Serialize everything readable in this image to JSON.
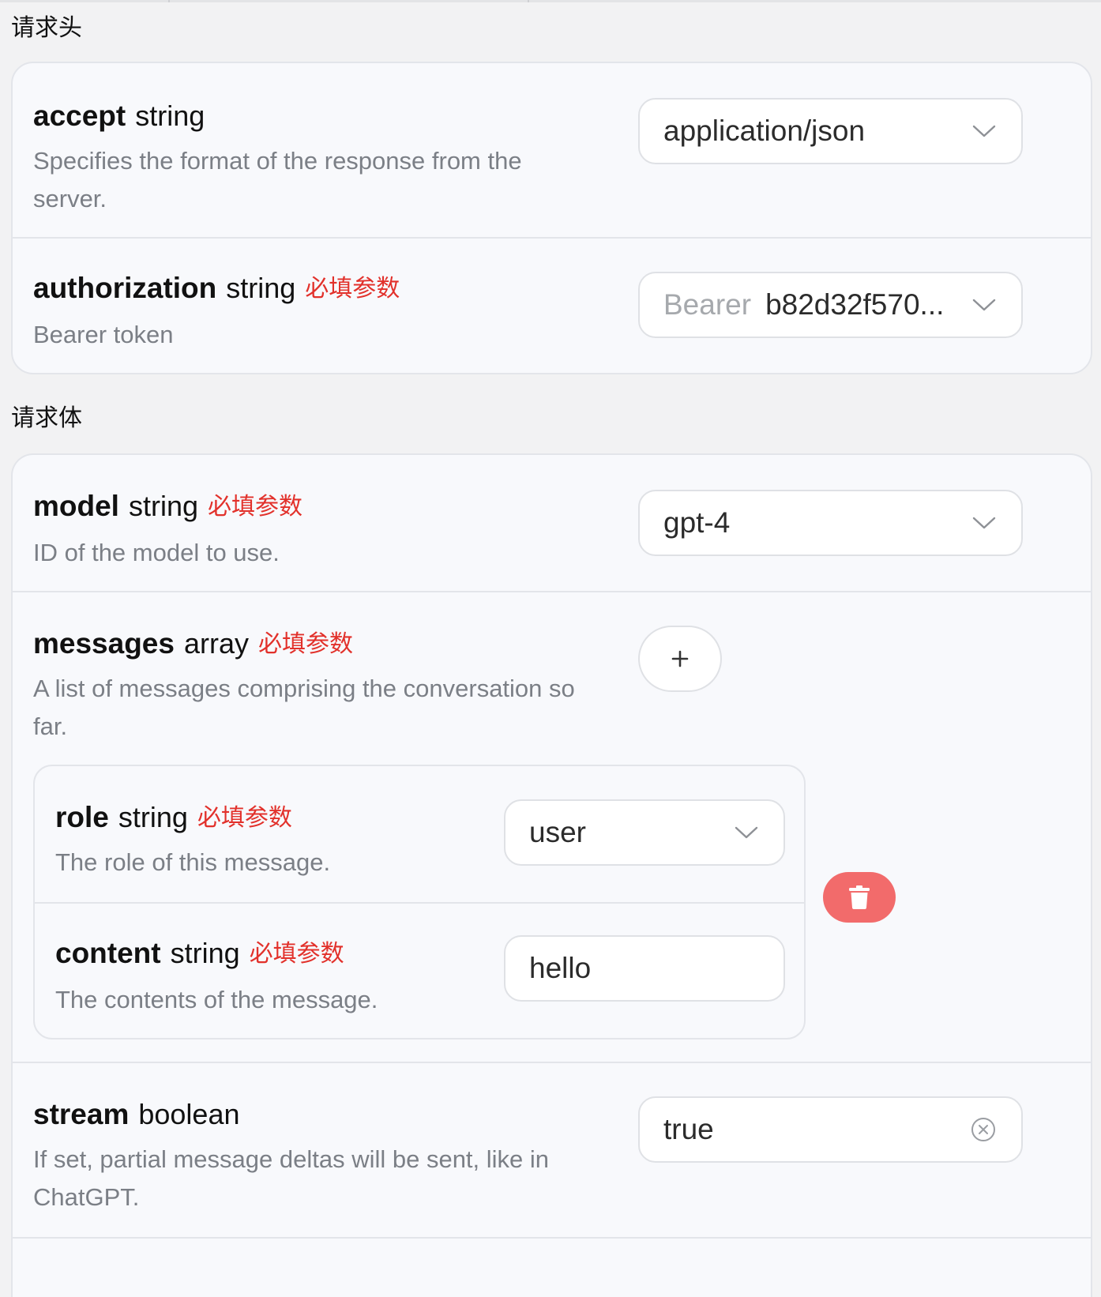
{
  "headers_section": {
    "title": "请求头",
    "params": [
      {
        "name": "accept",
        "type": "string",
        "required": false,
        "description_lines": [
          "Specifies the format of the response from the",
          "server."
        ],
        "value": "application/json",
        "control": "select"
      },
      {
        "name": "authorization",
        "type": "string",
        "required": true,
        "required_label": "必填参数",
        "description_lines": [
          "Bearer token"
        ],
        "value_prefix": "Bearer",
        "value": "b82d32f570...",
        "control": "select"
      }
    ]
  },
  "body_section": {
    "title": "请求体",
    "model": {
      "name": "model",
      "type": "string",
      "required_label": "必填参数",
      "description_lines": [
        "ID of the model to use."
      ],
      "value": "gpt-4",
      "control": "select"
    },
    "messages": {
      "name": "messages",
      "type": "array",
      "required_label": "必填参数",
      "description_lines": [
        "A list of messages comprising the conversation so",
        "far."
      ],
      "add_icon": "plus-icon",
      "delete_icon": "trash-icon",
      "item": {
        "role": {
          "name": "role",
          "type": "string",
          "required_label": "必填参数",
          "description_lines": [
            "The role of this message."
          ],
          "value": "user",
          "control": "select"
        },
        "content": {
          "name": "content",
          "type": "string",
          "required_label": "必填参数",
          "description_lines": [
            "The contents of the message."
          ],
          "value": "hello",
          "control": "text"
        }
      }
    },
    "stream": {
      "name": "stream",
      "type": "boolean",
      "required": false,
      "description_lines": [
        "If set, partial message deltas will be sent, like in",
        "ChatGPT."
      ],
      "value": "true",
      "control": "select-clearable"
    }
  },
  "colors": {
    "required": "#e2312b",
    "delete_button": "#f26b6b",
    "description": "#7b7f86",
    "card_bg": "#f8f9fc",
    "page_bg": "#f2f2f3"
  }
}
